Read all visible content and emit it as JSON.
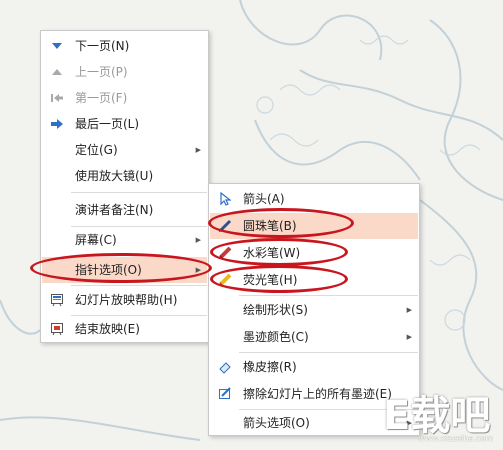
{
  "main_menu": {
    "items": [
      {
        "label": "下一页(N)",
        "icon": "arrow-down-icon",
        "enabled": true
      },
      {
        "label": "上一页(P)",
        "icon": "arrow-up-icon",
        "enabled": false
      },
      {
        "label": "第一页(F)",
        "icon": "first-page-icon",
        "enabled": false
      },
      {
        "label": "最后一页(L)",
        "icon": "last-page-icon",
        "enabled": true
      },
      {
        "label": "定位(G)",
        "enabled": true,
        "submenu": true
      },
      {
        "label": "使用放大镜(U)",
        "enabled": true
      },
      {
        "label": "演讲者备注(N)",
        "enabled": true
      },
      {
        "label": "屏幕(C)",
        "enabled": true,
        "submenu": true
      },
      {
        "label": "指针选项(O)",
        "enabled": true,
        "submenu": true,
        "highlighted": true
      },
      {
        "label": "幻灯片放映帮助(H)",
        "icon": "slideshow-help-icon",
        "enabled": true
      },
      {
        "label": "结束放映(E)",
        "icon": "end-show-icon",
        "enabled": true
      }
    ]
  },
  "pointer_submenu": {
    "items": [
      {
        "label": "箭头(A)",
        "icon": "arrow-pointer-icon"
      },
      {
        "label": "圆珠笔(B)",
        "icon": "ballpoint-pen-icon",
        "highlighted": true
      },
      {
        "label": "水彩笔(W)",
        "icon": "felt-tip-pen-icon"
      },
      {
        "label": "荧光笔(H)",
        "icon": "highlighter-icon"
      },
      {
        "label": "绘制形状(S)",
        "submenu": true
      },
      {
        "label": "墨迹颜色(C)",
        "submenu": true
      },
      {
        "label": "橡皮擦(R)",
        "icon": "eraser-icon"
      },
      {
        "label": "擦除幻灯片上的所有墨迹(E)",
        "icon": "erase-all-ink-icon"
      },
      {
        "label": "箭头选项(O)",
        "submenu": true
      }
    ]
  },
  "submenu_arrow": "▶",
  "watermark": {
    "text": "E载吧",
    "url": "www.xiazaiba.com"
  },
  "colors": {
    "highlight": "#fbd9c8",
    "annotation_oval": "#c9161e",
    "icon_blue": "#2f6fc6"
  }
}
